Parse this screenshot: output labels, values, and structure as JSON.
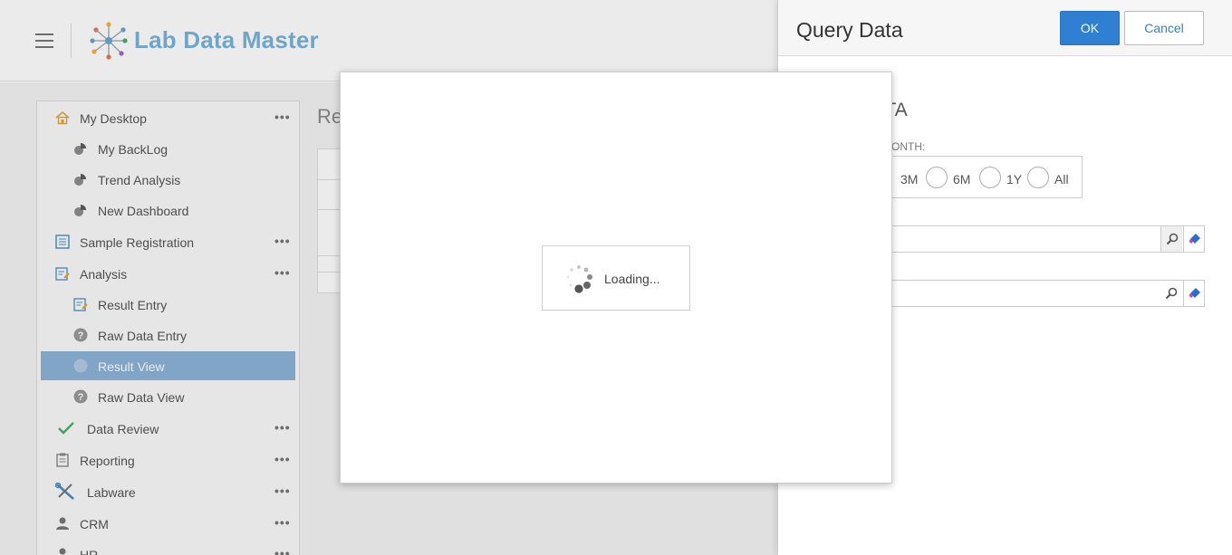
{
  "header": {
    "brand_name": "Lab Data Master"
  },
  "sidebar": {
    "items": [
      {
        "label": "My Desktop",
        "icon": "home-icon",
        "more": "•••"
      },
      {
        "label": "My BackLog",
        "icon": "dashboard-icon"
      },
      {
        "label": "Trend Analysis",
        "icon": "dashboard-icon"
      },
      {
        "label": "New Dashboard",
        "icon": "dashboard-icon"
      },
      {
        "label": "Sample Registration",
        "icon": "form-icon",
        "more": "•••"
      },
      {
        "label": "Analysis",
        "icon": "edit-form-icon",
        "more": "•••"
      },
      {
        "label": "Result Entry",
        "icon": "edit-form-icon"
      },
      {
        "label": "Raw Data Entry",
        "icon": "help-circle-icon"
      },
      {
        "label": "Result View",
        "icon": "help-circle-icon",
        "active": true
      },
      {
        "label": "Raw Data View",
        "icon": "help-circle-icon"
      },
      {
        "label": "Data Review",
        "icon": "checkmark-icon",
        "more": "•••"
      },
      {
        "label": "Reporting",
        "icon": "clipboard-icon",
        "more": "•••"
      },
      {
        "label": "Labware",
        "icon": "tools-icon",
        "more": "•••"
      },
      {
        "label": "CRM",
        "icon": "person-icon",
        "more": "•••"
      },
      {
        "label": "HR",
        "icon": "person-icon",
        "more": "•••"
      }
    ]
  },
  "content": {
    "title_fragment": "Re"
  },
  "query_panel": {
    "title": "Query Data",
    "ok_label": "OK",
    "cancel_label": "Cancel",
    "section_title": "ATA",
    "month_label": "ONTH:",
    "periods": [
      {
        "label": "3M"
      },
      {
        "label": "6M"
      },
      {
        "label": "1Y"
      },
      {
        "label": "All"
      }
    ],
    "field1_value": "",
    "field2_value": ""
  },
  "loading": {
    "text": "Loading..."
  },
  "colors": {
    "brand": "#79b5d8",
    "primary": "#2f7fd2",
    "active_nav": "#8bb3d8",
    "check": "#4cae6a"
  }
}
